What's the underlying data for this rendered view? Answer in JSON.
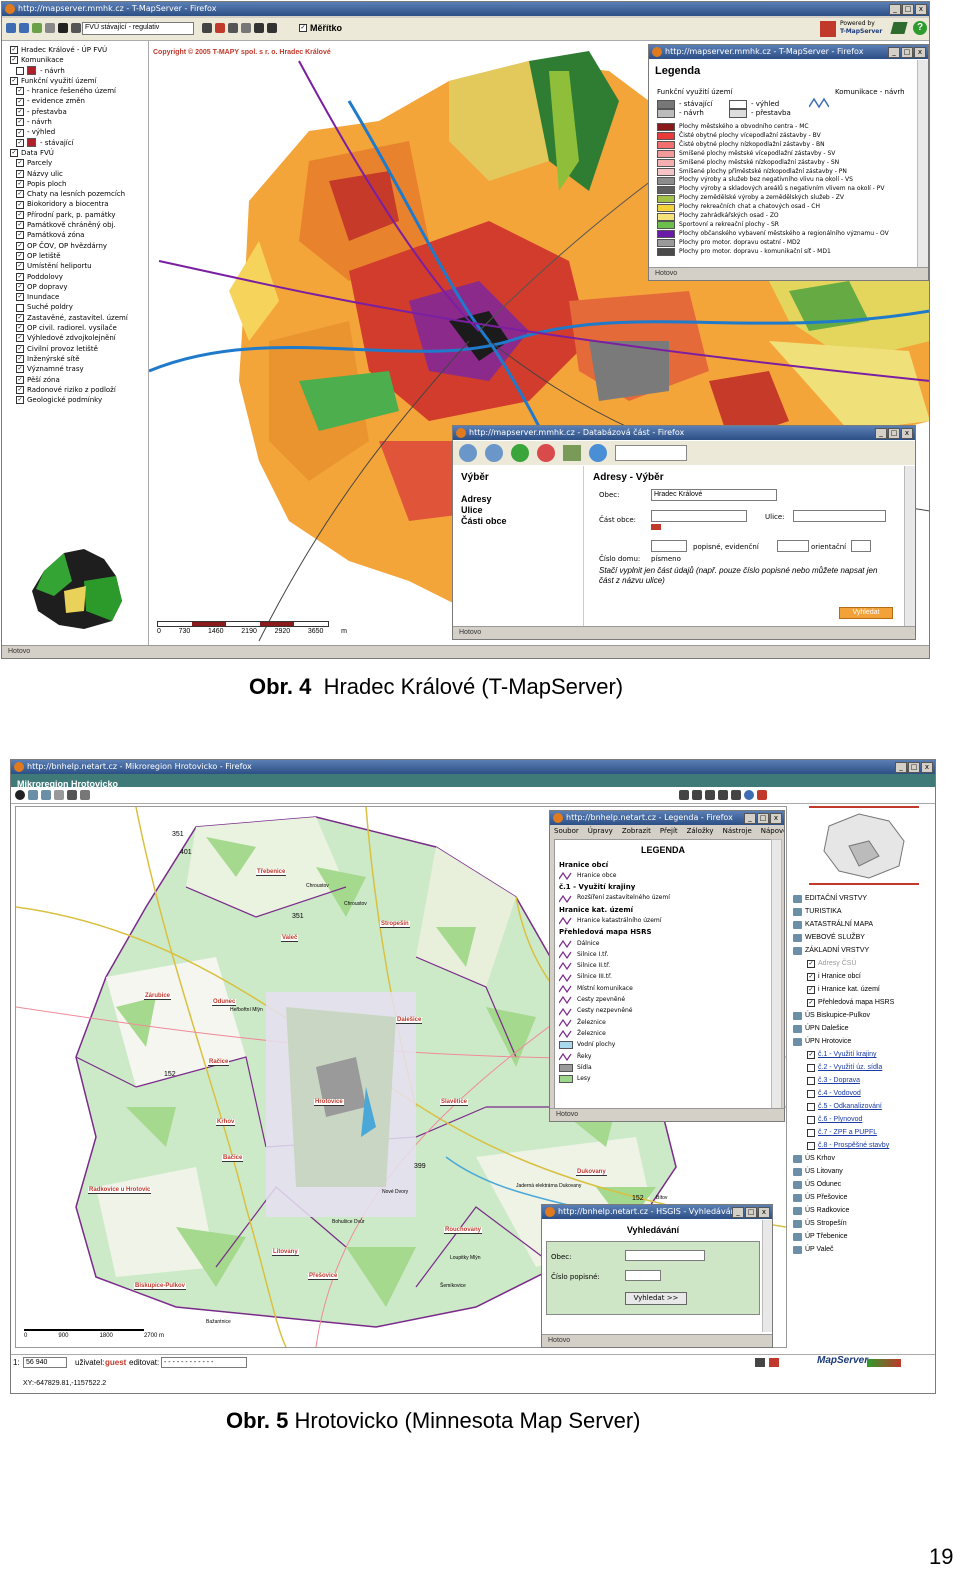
{
  "fig1": {
    "browser_title": "http://mapserver.mmhk.cz - T-MapServer - Firefox",
    "toolbar_select": "FVÚ stávající - regulativ",
    "scale_checkbox_label": "Měřítko",
    "powered_by": [
      "Powered by",
      "T-MapServer"
    ],
    "copyright": "Copyright © 2005 T-MAPY spol. s r. o. Hradec Králové",
    "layers": [
      {
        "label": "Hradec Králové - ÚP FVÚ",
        "checked": true
      },
      {
        "label": "Komunikace",
        "checked": true
      },
      {
        "label": "- návrh",
        "checked": false,
        "swatch": "#b0202a"
      },
      {
        "label": "Funkční využití území",
        "checked": true
      },
      {
        "label": "- hranice řešeného území",
        "checked": true
      },
      {
        "label": "- evidence změn",
        "checked": true
      },
      {
        "label": "- přestavba",
        "checked": true
      },
      {
        "label": "- návrh",
        "checked": true
      },
      {
        "label": "- výhled",
        "checked": true
      },
      {
        "label": "- stávající",
        "checked": true,
        "swatch": "#b0202a"
      },
      {
        "label": "Data FVÚ",
        "checked": true
      },
      {
        "label": "Parcely",
        "checked": true
      },
      {
        "label": "Názvy ulic",
        "checked": true
      },
      {
        "label": "Popis ploch",
        "checked": true
      },
      {
        "label": "Chaty na lesních pozemcích",
        "checked": true
      },
      {
        "label": "Biokoridory a biocentra",
        "checked": true
      },
      {
        "label": "Přírodní park, p. památky",
        "checked": true
      },
      {
        "label": "Památkově chráněný obj.",
        "checked": true
      },
      {
        "label": "Památková zóna",
        "checked": true
      },
      {
        "label": "OP ČOV, OP hvězdárny",
        "checked": true
      },
      {
        "label": "OP letiště",
        "checked": true
      },
      {
        "label": "Umístění heliportu",
        "checked": true
      },
      {
        "label": "Poddolovy",
        "checked": true
      },
      {
        "label": "OP dopravy",
        "checked": true
      },
      {
        "label": "Inundace",
        "checked": true
      },
      {
        "label": "Suché poldry",
        "checked": false
      },
      {
        "label": "Zastavěné, zastavitel. území",
        "checked": true
      },
      {
        "label": "OP civil. radiorel. vysílače",
        "checked": true
      },
      {
        "label": "Výhledové zdvojkolejnění",
        "checked": true
      },
      {
        "label": "Civilní provoz letiště",
        "checked": true
      },
      {
        "label": "Inženýrské sítě",
        "checked": true
      },
      {
        "label": "Významné trasy",
        "checked": true
      },
      {
        "label": "Pěší zóna",
        "checked": true
      },
      {
        "label": "Radonové riziko z podloží",
        "checked": true
      },
      {
        "label": "Geologické podmínky",
        "checked": true
      }
    ],
    "scale_labels": [
      "0",
      "730",
      "1460",
      "2190",
      "2920",
      "3650",
      "m"
    ],
    "status": "Hotovo",
    "legend_window": {
      "title": "http://mapserver.mmhk.cz - T-MapServer - Firefox",
      "heading": "Legenda",
      "group1": "Funkční využití území",
      "group2": "Komunikace - návrh",
      "states": [
        "- stávající",
        "- výhled",
        "- návrh",
        "- přestavba"
      ],
      "items": [
        {
          "color": "#8a1a1a",
          "label": "Plochy městského a obvodního centra - MC"
        },
        {
          "color": "#e83a3a",
          "label": "Čisté obytné plochy vícepodlažní zástavby - BV"
        },
        {
          "color": "#f07070",
          "label": "Čisté obytné plochy nízkopodlažní zástavby - BN"
        },
        {
          "color": "#f29a9a",
          "label": "Smíšené plochy městské vícepodlažní zástavby - SV"
        },
        {
          "color": "#f4b0b0",
          "label": "Smíšené plochy městské nízkopodlažní zástavby - SN"
        },
        {
          "color": "#f6c4c4",
          "label": "Smíšené plochy příměstské nízkopodlažní zástavby - PN"
        },
        {
          "color": "#8c8c8c",
          "label": "Plochy výroby a služeb bez negativního vlivu na okolí - VS"
        },
        {
          "color": "#5e5e5e",
          "label": "Plochy výroby a skladových areálů s negativním vlivem na okolí - PV"
        },
        {
          "color": "#a3c24a",
          "label": "Plochy zemědělské výroby a zemědělských služeb - ZV"
        },
        {
          "color": "#f3d23a",
          "label": "Plochy rekreačních chat a chatových osad - CH"
        },
        {
          "color": "#f6e27a",
          "label": "Plochy zahrádkářských osad - ZO"
        },
        {
          "color": "#6cbf4a",
          "label": "Sportovní a rekreační plochy - SR"
        },
        {
          "color": "#6a1aa8",
          "label": "Plochy občanského vybavení městského a regionálního významu - OV"
        },
        {
          "color": "#9a9a9a",
          "label": "Plochy pro motor. dopravu ostatní - MD2"
        },
        {
          "color": "#4a4a4a",
          "label": "Plochy pro motor. dopravu - komunikační síť - MD1"
        }
      ],
      "status": "Hotovo"
    },
    "search_window": {
      "title": "http://mapserver.mmhk.cz - Databázová část - Firefox",
      "left_heading": "Výběr",
      "left_links": [
        "Adresy",
        "Ulice",
        "Části obce"
      ],
      "form_heading": "Adresy - Výběr",
      "label_obec": "Obec:",
      "value_obec": "Hradec Králové",
      "label_cast": "Část obce:",
      "label_ulice": "Ulice:",
      "label_cislo": "Číslo domu:",
      "label_popisne": "popisné, evidenční",
      "label_orientacni": "orientační",
      "label_pismeno": "písmeno",
      "hint": "Stačí vyplnit jen část údajů (např. pouze číslo popisné nebo můžete napsat jen část z názvu ulice)",
      "button": "Vyhledat",
      "status": "Hotovo"
    }
  },
  "caption1": {
    "num": "Obr. 4",
    "text": "Hradec Králové (T-MapServer)"
  },
  "fig2": {
    "browser_title": "http://bnhelp.netart.cz - Mikroregion Hrotovicko - Firefox",
    "app_title": "Mikroregion Hrotovicko",
    "legend_window": {
      "title": "http://bnhelp.netart.cz - Legenda - Firefox",
      "menu": [
        "Soubor",
        "Úpravy",
        "Zobrazit",
        "Přejít",
        "Záložky",
        "Nástroje",
        "Nápověda"
      ],
      "heading": "LEGENDA",
      "items": [
        {
          "label": "Hranice obcí",
          "head": true
        },
        {
          "label": "Hranice obce",
          "sym": "line"
        },
        {
          "label": "č.1 - Využití krajiny",
          "head": true
        },
        {
          "label": "Rozšíření zastavitelného území",
          "sym": "line"
        },
        {
          "label": "Hranice kat. území",
          "head": true
        },
        {
          "label": "Hranice katastrálního území",
          "sym": "line"
        },
        {
          "label": "Přehledová mapa HSRS",
          "head": true
        },
        {
          "label": "Dálnice",
          "sym": "line"
        },
        {
          "label": "Silnice I.tř.",
          "sym": "line"
        },
        {
          "label": "Silnice II.tř.",
          "sym": "line"
        },
        {
          "label": "Silnice III.tř.",
          "sym": "line"
        },
        {
          "label": "Místní komunikace",
          "sym": "line"
        },
        {
          "label": "Cesty zpevněné",
          "sym": "line"
        },
        {
          "label": "Cesty nezpevněné",
          "sym": "line"
        },
        {
          "label": "Železnice",
          "sym": "line"
        },
        {
          "label": "Železnice",
          "sym": "line"
        },
        {
          "label": "Vodní plochy",
          "sym": "box",
          "color": "#a9d8ef"
        },
        {
          "label": "Řeky",
          "sym": "line"
        },
        {
          "label": "Sídla",
          "sym": "box",
          "color": "#9a9a9a"
        },
        {
          "label": "Lesy",
          "sym": "box",
          "color": "#9fd78a"
        }
      ],
      "status": "Hotovo"
    },
    "search_window": {
      "title": "http://bnhelp.netart.cz - HSGIS - Vyhledávání",
      "heading": "Vyhledávání",
      "label_obec": "Obec:",
      "label_cislo": "Číslo popisné:",
      "button": "Vyhledat >>",
      "status": "Hotovo"
    },
    "right_layers": [
      {
        "label": "EDITAČNÍ VRSTVY",
        "kind": "group"
      },
      {
        "label": "TURISTIKA",
        "kind": "group"
      },
      {
        "label": "KATASTRÁLNÍ MAPA",
        "kind": "group"
      },
      {
        "label": "WEBOVÉ SLUŽBY",
        "kind": "group"
      },
      {
        "label": "ZÁKLADNÍ VRSTVY",
        "kind": "group"
      },
      {
        "label": "Adresy ČSÚ",
        "kind": "check",
        "checked": true
      },
      {
        "label": "i Hranice obcí",
        "kind": "check",
        "checked": true
      },
      {
        "label": "i Hranice kat. území",
        "kind": "check",
        "checked": true
      },
      {
        "label": "Přehledová mapa HSRS",
        "kind": "check",
        "checked": true
      },
      {
        "label": "ÚS Biskupice-Pulkov",
        "kind": "group"
      },
      {
        "label": "ÚPN Dalešice",
        "kind": "group"
      },
      {
        "label": "ÚPN Hrotovice",
        "kind": "group"
      },
      {
        "label": "č.1 - Využití krajiny",
        "kind": "check",
        "checked": true,
        "link": true
      },
      {
        "label": "č.2 - Využití úz. sídla",
        "kind": "check",
        "checked": false,
        "link": true
      },
      {
        "label": "č.3 - Doprava",
        "kind": "check",
        "checked": false,
        "link": true
      },
      {
        "label": "č.4 - Vodovod",
        "kind": "check",
        "checked": false,
        "link": true
      },
      {
        "label": "č.5 - Odkanalizování",
        "kind": "check",
        "checked": false,
        "link": true
      },
      {
        "label": "č.6 - Plynovod",
        "kind": "check",
        "checked": false,
        "link": true
      },
      {
        "label": "č.7 - ZPF a PUPFL",
        "kind": "check",
        "checked": false,
        "link": true
      },
      {
        "label": "č.8 - Prospěšné stavby",
        "kind": "check",
        "checked": false,
        "link": true
      },
      {
        "label": "ÚS Krhov",
        "kind": "group"
      },
      {
        "label": "ÚS Litovany",
        "kind": "group"
      },
      {
        "label": "ÚS Odunec",
        "kind": "group"
      },
      {
        "label": "ÚS Přešovice",
        "kind": "group"
      },
      {
        "label": "ÚS Radkovice",
        "kind": "group"
      },
      {
        "label": "ÚS Stropešín",
        "kind": "group"
      },
      {
        "label": "ÚP Třebenice",
        "kind": "group"
      },
      {
        "label": "ÚP Valeč",
        "kind": "group"
      }
    ],
    "towns": [
      {
        "label": "Třebenice"
      },
      {
        "label": "Stropešín"
      },
      {
        "label": "Valeč"
      },
      {
        "label": "Zárubice"
      },
      {
        "label": "Odunec"
      },
      {
        "label": "Dalešice"
      },
      {
        "label": "Račice"
      },
      {
        "label": "Hrotovice"
      },
      {
        "label": "Slavětice"
      },
      {
        "label": "Krhov"
      },
      {
        "label": "Bačice"
      },
      {
        "label": "Radkovice u Hrotovic"
      },
      {
        "label": "Dukovany"
      },
      {
        "label": "Litovany"
      },
      {
        "label": "Rouchovany"
      },
      {
        "label": "Přešovice"
      },
      {
        "label": "Biskupice-Pulkov"
      }
    ],
    "map_labels": [
      "Chroustov",
      "Heřbořtní Mlýn",
      "Nové Dvory",
      "Jaderná elektrárna Dukovany",
      "Bohušice Dvůr",
      "Lipňany",
      "Loupitky Mlýn",
      "Šemíkovice",
      "Bažantnice",
      "Bítov",
      "Slavíčky"
    ],
    "road_numbers": [
      "351",
      "401",
      "351",
      "152",
      "399",
      "152"
    ],
    "scale_labels": [
      "0",
      "900",
      "1800",
      "2700 m"
    ],
    "statusbar": {
      "scale_prefix": "1:",
      "scale_value": "56 940",
      "user_label": "uživatel:",
      "user_value": "guest",
      "edit_label": "editovat:",
      "edit_value": "- - - - - - - - - - - -",
      "coords": "XY:-647829.81,-1157522.2"
    },
    "logo": "MapServer"
  },
  "caption2": {
    "num": "Obr. 5",
    "text": "Hrotovicko (Minnesota Map Server)"
  },
  "page_number": "19"
}
